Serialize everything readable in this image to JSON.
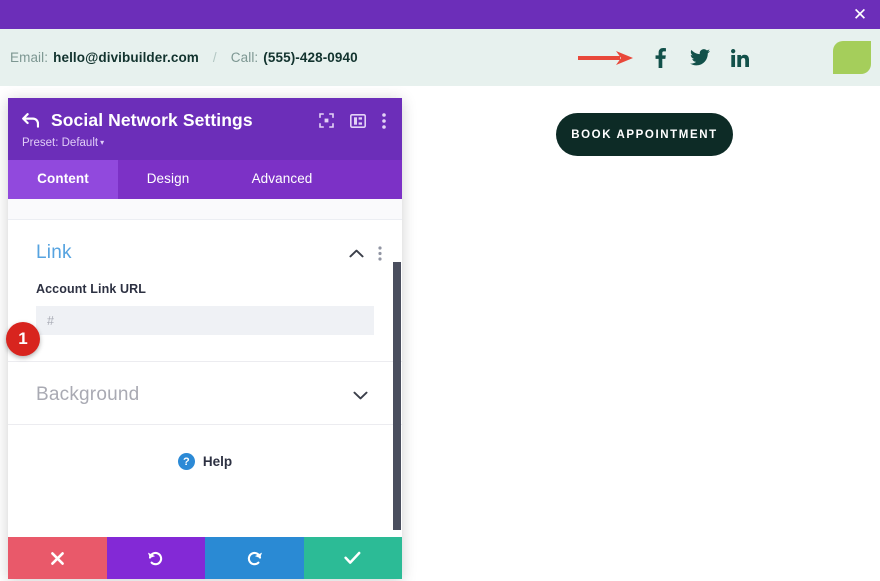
{
  "page": {
    "admin_bar": {
      "close_label": "✕"
    },
    "contact": {
      "email_label": "Email:",
      "email_value": "hello@divibuilder.com",
      "separator": "/",
      "phone_label": "Call:",
      "phone_value": "(555)-428-0940"
    },
    "social": [
      {
        "name": "facebook",
        "glyph": "f"
      },
      {
        "name": "twitter",
        "glyph": "twitter"
      },
      {
        "name": "linkedin",
        "glyph": "in"
      }
    ],
    "cta": {
      "label": "BOOK APPOINTMENT"
    },
    "colors": {
      "admin_purple": "#6c2eb9",
      "contact_bg": "#e7f1ee",
      "contact_value": "#12332e",
      "social_icon": "#12514a",
      "green_shape": "#a5ce5b",
      "cta_bg": "#0d2b26",
      "arrow_red": "#e8483a"
    }
  },
  "modal": {
    "back_icon": "back-arrow-icon",
    "title": "Social Network Settings",
    "preset_label": "Preset: Default",
    "preset_caret": "▾",
    "header_icons": [
      {
        "name": "focus-module-icon"
      },
      {
        "name": "layout-view-icon"
      },
      {
        "name": "more-options-icon"
      }
    ],
    "tabs": [
      {
        "label": "Content",
        "active": true
      },
      {
        "label": "Design",
        "active": false
      },
      {
        "label": "Advanced",
        "active": false
      }
    ],
    "sections": [
      {
        "title": "Link",
        "state": "open",
        "chevron": "chevron-up-icon",
        "field_label": "Account Link URL",
        "field_value": "",
        "field_placeholder": "#"
      },
      {
        "title": "Background",
        "state": "closed",
        "chevron": "chevron-down-icon"
      }
    ],
    "help": {
      "icon": "?",
      "label": "Help"
    },
    "footer": [
      {
        "name": "cancel",
        "glyph": "✖",
        "color": "#e9596a"
      },
      {
        "name": "undo",
        "glyph": "undo-icon",
        "color": "#8329d6"
      },
      {
        "name": "redo",
        "glyph": "redo-icon",
        "color": "#2a8ad4"
      },
      {
        "name": "save",
        "glyph": "✔",
        "color": "#2cbb96"
      }
    ]
  },
  "annotation": {
    "badge_number": "1",
    "arrow": "red-arrow-right"
  }
}
